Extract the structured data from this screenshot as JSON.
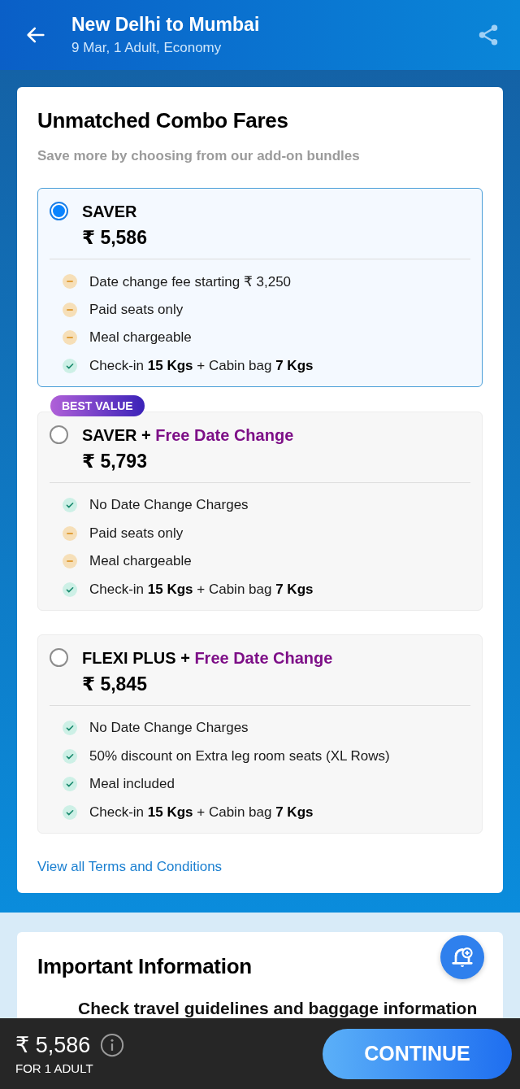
{
  "header": {
    "title": "New Delhi to Mumbai",
    "subtitle": "9 Mar, 1 Adult, Economy"
  },
  "fares": {
    "title": "Unmatched Combo Fares",
    "subtitle": "Save more by choosing from our add-on bundles",
    "options": [
      {
        "name": "SAVER",
        "price": "₹ 5,586",
        "selected": true,
        "features": [
          {
            "kind": "minus",
            "text": "Date change fee starting ₹ 3,250"
          },
          {
            "kind": "minus",
            "text": "Paid seats only"
          },
          {
            "kind": "minus",
            "text": "Meal chargeable"
          },
          {
            "kind": "check",
            "text": "Check-in **15 Kgs** + Cabin bag **7 Kgs**"
          }
        ]
      },
      {
        "name": "SAVER",
        "separator": "+",
        "addon": "Free Date Change",
        "price": "₹ 5,793",
        "selected": false,
        "badge": "BEST VALUE",
        "features": [
          {
            "kind": "check",
            "text": "No Date Change Charges"
          },
          {
            "kind": "minus",
            "text": "Paid seats only"
          },
          {
            "kind": "minus",
            "text": "Meal chargeable"
          },
          {
            "kind": "check",
            "text": "Check-in **15 Kgs** + Cabin bag **7 Kgs**"
          }
        ]
      },
      {
        "name": "FLEXI PLUS",
        "separator": "+",
        "addon": "Free Date Change",
        "price": "₹ 5,845",
        "selected": false,
        "features": [
          {
            "kind": "check",
            "text": "No Date Change Charges"
          },
          {
            "kind": "check",
            "text": "50% discount on Extra leg room seats (XL Rows)"
          },
          {
            "kind": "check",
            "text": "Meal included"
          },
          {
            "kind": "check",
            "text": "Check-in **15 Kgs** + Cabin bag **7 Kgs**"
          }
        ]
      }
    ],
    "terms_link": "View all Terms and Conditions"
  },
  "info": {
    "title": "Important Information",
    "item": "Check travel guidelines and baggage information"
  },
  "footer": {
    "price": "₹ 5,586",
    "caption": "FOR 1 ADULT",
    "button": "CONTINUE"
  }
}
